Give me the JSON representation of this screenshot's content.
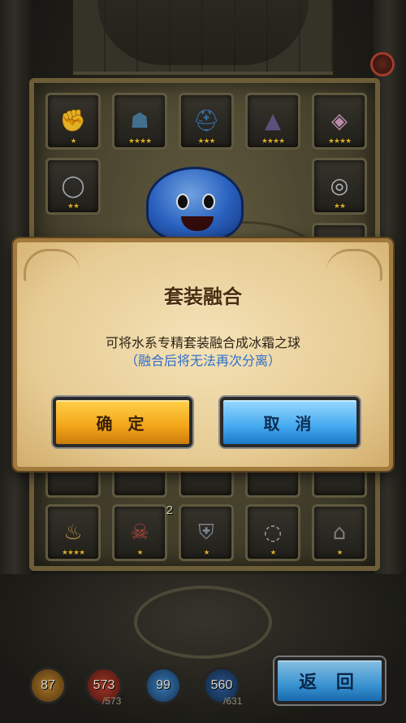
{
  "dialog": {
    "title": "套装融合",
    "message": "可将水系专精套装融合成冰霜之球",
    "note": "（融合后将无法再次分离）",
    "confirm_label": "确 定",
    "cancel_label": "取 消"
  },
  "inventory": {
    "top_row": [
      {
        "icon": "gauntlet-icon",
        "glyph": "✊",
        "stars": "★"
      },
      {
        "icon": "hood-icon",
        "glyph": "☗",
        "stars": "★★★★"
      },
      {
        "icon": "helmet-icon",
        "glyph": "⛑",
        "stars": "★★★"
      },
      {
        "icon": "witch-hat-icon",
        "glyph": "▲",
        "stars": "★★★★"
      },
      {
        "icon": "gem-necklace-icon",
        "glyph": "◈",
        "stars": "★★★★"
      }
    ],
    "second_row": [
      {
        "icon": "ring-icon",
        "glyph": "◯",
        "stars": "★★"
      },
      {
        "icon": "silver-ring-icon",
        "glyph": "◎",
        "stars": "★★"
      }
    ],
    "bottom_row": [
      {
        "icon": "pouch-icon",
        "glyph": "♨",
        "stars": "★★★★",
        "count": ""
      },
      {
        "icon": "demon-mask-icon",
        "glyph": "☠",
        "stars": "★",
        "count": "2"
      },
      {
        "icon": "chest-armor-icon",
        "glyph": "⛨",
        "stars": "★",
        "count": ""
      },
      {
        "icon": "amulet-ring-icon",
        "glyph": "◌",
        "stars": "★",
        "count": ""
      },
      {
        "icon": "cape-icon",
        "glyph": "⌂",
        "stars": "★",
        "count": ""
      }
    ]
  },
  "status": {
    "gold": "87",
    "hp": "573",
    "hp_max": "/573",
    "attack": "99",
    "mp": "560",
    "mp_max": "/631"
  },
  "back_label": "返 回",
  "colors": {
    "confirm": "#f2a518",
    "cancel": "#43a9ef",
    "note_text": "#2e6fcb",
    "stars": "#f2c531"
  }
}
